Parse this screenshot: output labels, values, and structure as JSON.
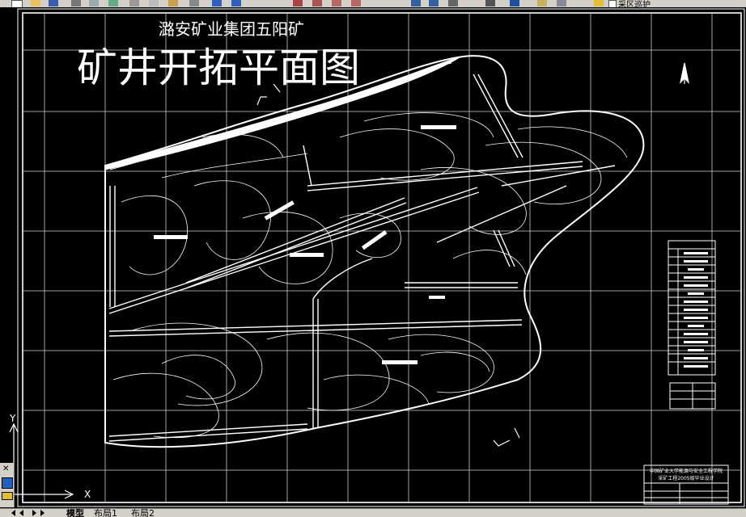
{
  "toolbar": {
    "layer_label": "采区巡护"
  },
  "drawing": {
    "subtitle": "潞安矿业集团五阳矿",
    "title": "矿井开拓平面图",
    "title_block": {
      "line1": "中国矿业大学能源与安全工程学院",
      "line2": "采矿工程2005级毕业设计"
    },
    "section_mark_top": "I",
    "section_mark_bottom": "I"
  },
  "ucs": {
    "x_label": "X",
    "y_label": "Y"
  },
  "tabs": {
    "model": "模型",
    "layout1": "布局1",
    "layout2": "布局2"
  },
  "colors": {
    "background": "#000000",
    "lines": "#ffffff",
    "grid": "#cfcfcf",
    "chrome": "#d4d0c8"
  }
}
